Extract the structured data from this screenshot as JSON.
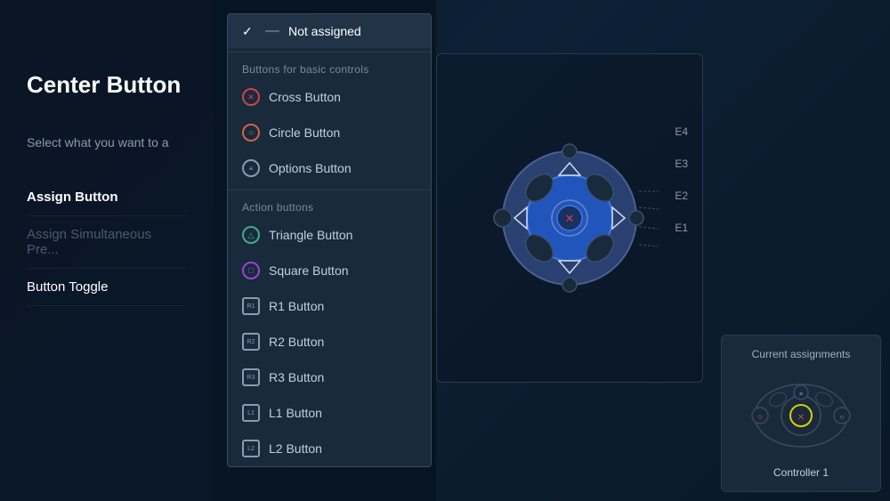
{
  "page": {
    "title": "Center Button",
    "subtitle": "Select what you want to a",
    "bg_color": "#0d1f2d"
  },
  "menu": {
    "items": [
      {
        "id": "assign-button",
        "label": "Assign Button",
        "active": true,
        "disabled": false
      },
      {
        "id": "assign-simultaneous",
        "label": "Assign Simultaneous Pre...",
        "active": false,
        "disabled": true
      },
      {
        "id": "button-toggle",
        "label": "Button Toggle",
        "active": false,
        "disabled": false
      }
    ]
  },
  "dropdown": {
    "selected": "Not assigned",
    "categories": [
      {
        "id": "basic",
        "label": "Buttons for basic controls",
        "items": [
          {
            "id": "cross",
            "label": "Cross Button",
            "icon": "cross"
          },
          {
            "id": "circle",
            "label": "Circle Button",
            "icon": "circle"
          },
          {
            "id": "options",
            "label": "Options Button",
            "icon": "options"
          }
        ]
      },
      {
        "id": "action",
        "label": "Action buttons",
        "items": [
          {
            "id": "triangle",
            "label": "Triangle Button",
            "icon": "triangle"
          },
          {
            "id": "square",
            "label": "Square Button",
            "icon": "square"
          },
          {
            "id": "r1",
            "label": "R1 Button",
            "icon": "r1"
          },
          {
            "id": "r2",
            "label": "R2 Button",
            "icon": "r2"
          },
          {
            "id": "r3",
            "label": "R3 Button",
            "icon": "r3"
          },
          {
            "id": "l1",
            "label": "L1 Button",
            "icon": "l1"
          },
          {
            "id": "l2",
            "label": "L2 Button",
            "icon": "l2"
          }
        ]
      }
    ]
  },
  "e_labels": [
    "E4",
    "E3",
    "E2",
    "E1"
  ],
  "assignments": {
    "title": "Current assignments",
    "controller": "Controller 1"
  },
  "icons": {
    "cross_char": "✕",
    "circle_char": "○",
    "options_char": "≡",
    "triangle_char": "△",
    "square_char": "□",
    "r1_char": "R1",
    "r2_char": "R2",
    "r3_char": "R3",
    "l1_char": "L1",
    "l2_char": "L2",
    "check_char": "✓",
    "dash_char": "—"
  }
}
